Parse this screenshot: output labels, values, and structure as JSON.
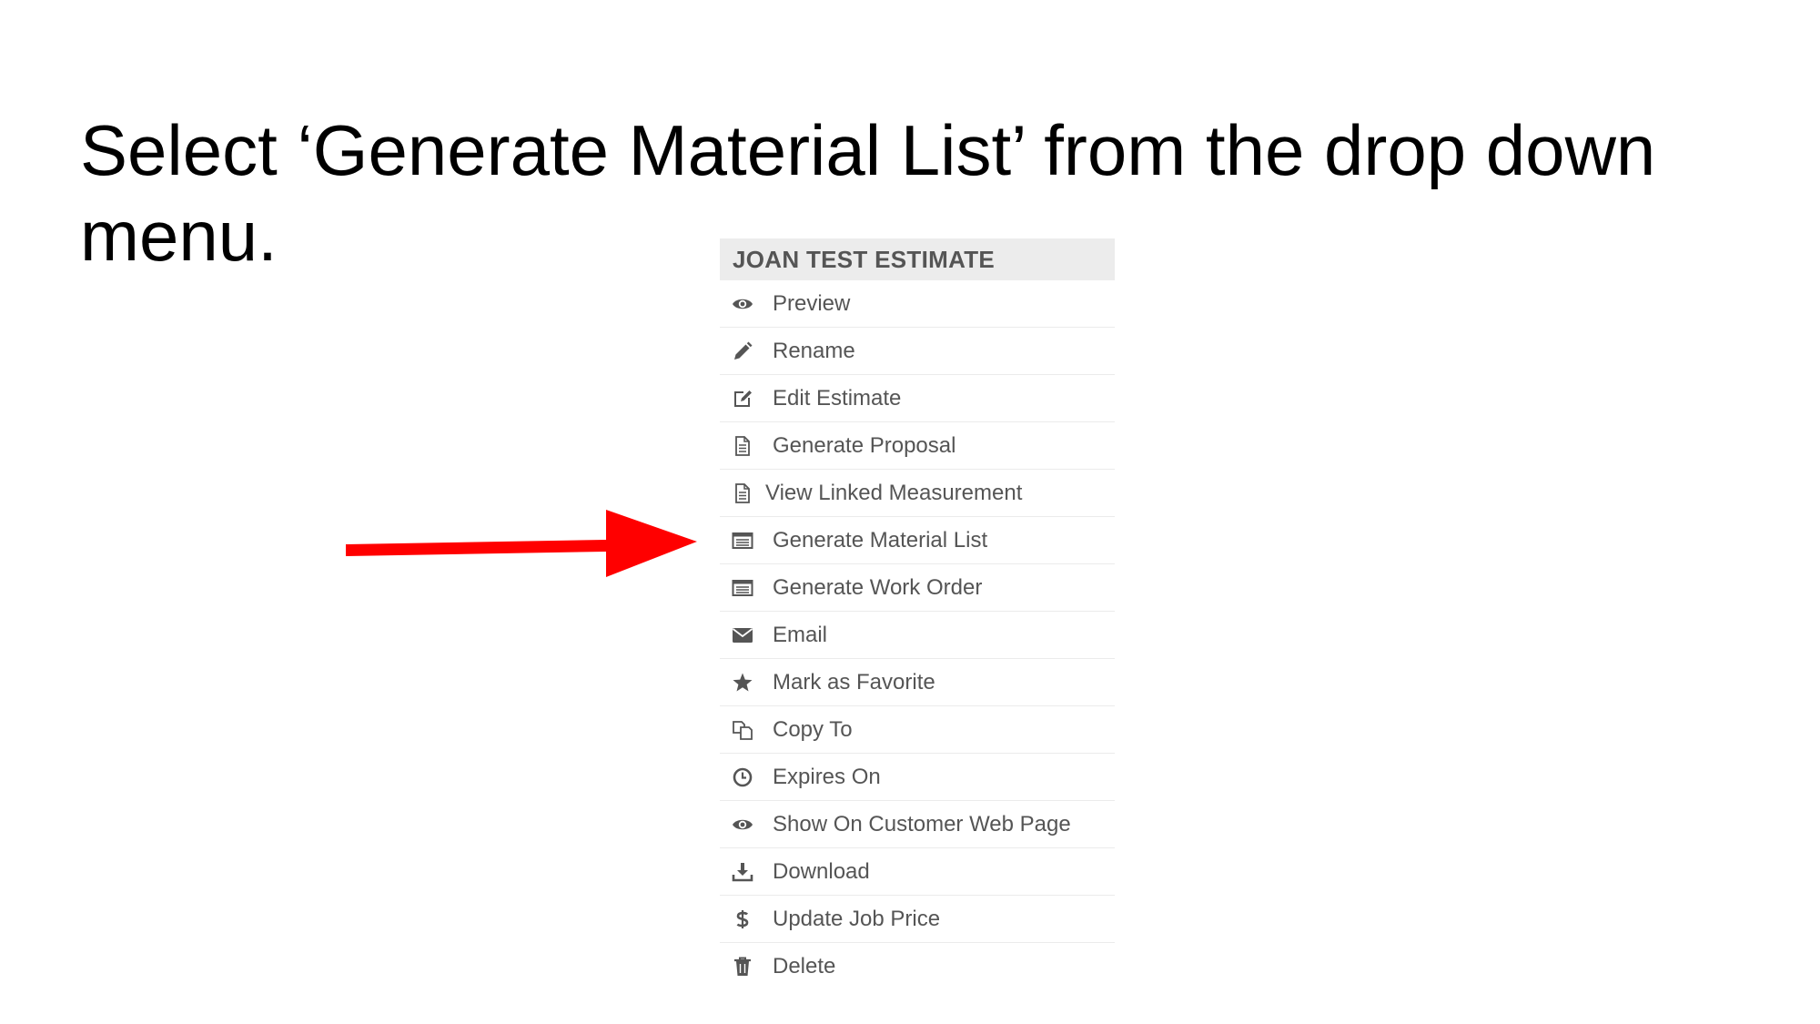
{
  "instruction": "Select ‘Generate Material List’ from the drop down menu.",
  "menu": {
    "title": "JOAN TEST ESTIMATE",
    "items": [
      {
        "label": "Preview",
        "icon": "eye-icon"
      },
      {
        "label": "Rename",
        "icon": "pencil-icon"
      },
      {
        "label": "Edit Estimate",
        "icon": "edit-icon"
      },
      {
        "label": "Generate Proposal",
        "icon": "document-icon"
      },
      {
        "label": "View Linked Measurement",
        "icon": "document-icon"
      },
      {
        "label": "Generate Material List",
        "icon": "list-icon"
      },
      {
        "label": "Generate Work Order",
        "icon": "list-icon"
      },
      {
        "label": "Email",
        "icon": "envelope-icon"
      },
      {
        "label": "Mark as Favorite",
        "icon": "star-icon"
      },
      {
        "label": "Copy To",
        "icon": "copy-icon"
      },
      {
        "label": "Expires On",
        "icon": "clock-icon"
      },
      {
        "label": "Show On Customer Web Page",
        "icon": "eye-icon"
      },
      {
        "label": "Download",
        "icon": "download-icon"
      },
      {
        "label": "Update Job Price",
        "icon": "dollar-icon"
      },
      {
        "label": "Delete",
        "icon": "trash-icon"
      }
    ]
  },
  "annotation": {
    "arrow_color": "#ff0000",
    "points_to": "Generate Material List",
    "icon_color": "#555555"
  }
}
